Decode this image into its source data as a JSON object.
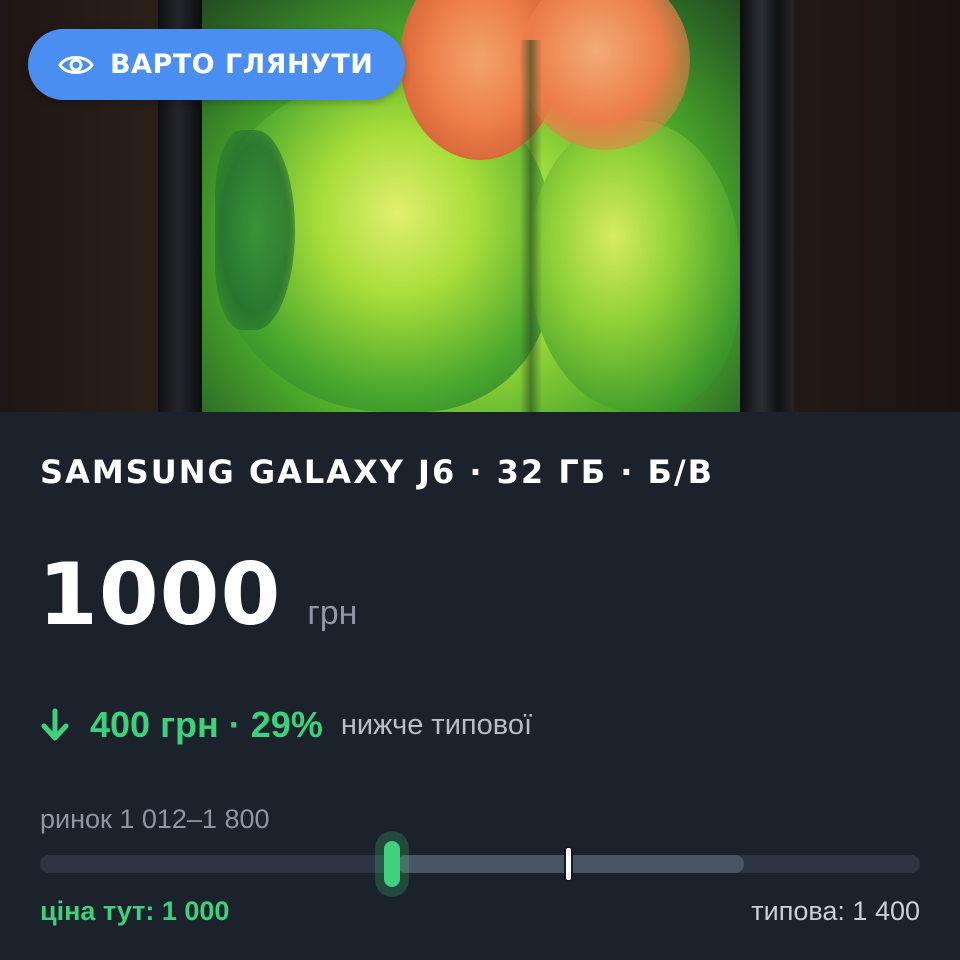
{
  "badge": {
    "icon": "eye-icon",
    "label": "ВАРТО ГЛЯНУТИ",
    "color": "#4a8ef2"
  },
  "listing": {
    "title": "SAMSUNG GALAXY J6 · 32 ГБ · Б/В",
    "price": "1000",
    "currency": "грн"
  },
  "discount": {
    "icon": "arrow-down-icon",
    "text": "400 грн · 29%",
    "note": "нижче типової",
    "color": "#3dd17c"
  },
  "market": {
    "range_label": "ринок 1 012–1 800",
    "price_here_label": "ціна тут: 1 000",
    "typical_label": "типова: 1 400",
    "scale_min": 200,
    "scale_max": 2200,
    "range_low": 1012,
    "range_high": 1800,
    "price_value": 1000,
    "typical_value": 1400
  }
}
